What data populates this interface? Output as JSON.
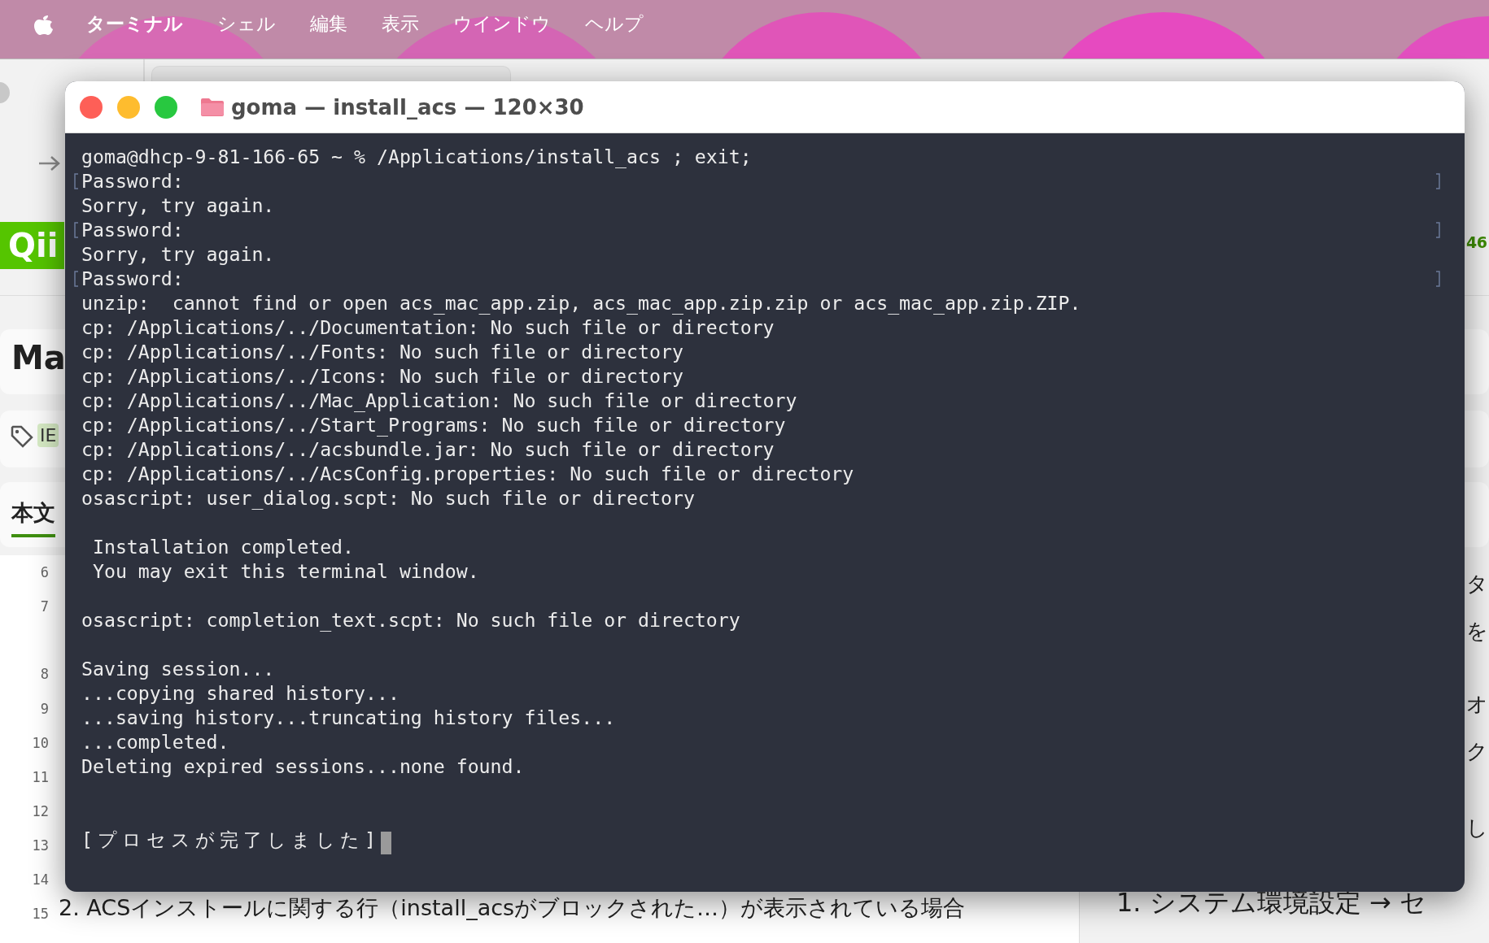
{
  "menu_bar": {
    "items": [
      {
        "label": "ターミナル",
        "selected": true
      },
      {
        "label": "シェル",
        "selected": false
      },
      {
        "label": "編集",
        "selected": false
      },
      {
        "label": "表示",
        "selected": false
      },
      {
        "label": "ウインドウ",
        "selected": false
      },
      {
        "label": "ヘルプ",
        "selected": false
      }
    ]
  },
  "background_page": {
    "logo": "Qii",
    "title": "Ma",
    "tag": "IE",
    "tab": "本文",
    "count": "46",
    "line_numbers": [
      "6",
      "7",
      "8",
      "9",
      "10",
      "11",
      "12",
      "13",
      "14",
      "15"
    ],
    "editor_lines": [
      "2. ACSインストールに関する行（install_acsがブロックされた…）が表示されている場合"
    ],
    "preview_fragments": [
      "タ",
      "を",
      "オ",
      "ク",
      "し"
    ],
    "preview_lines": [
      "1. システム環境設定 → セ"
    ]
  },
  "terminal": {
    "title": "goma — install_acs — 120×30",
    "lines": [
      {
        "kind": "text",
        "text": "goma@dhcp-9-81-166-65 ~ % /Applications/install_acs ; exit;",
        "marked": false
      },
      {
        "kind": "text",
        "text": "Password:",
        "marked": true
      },
      {
        "kind": "text",
        "text": "Sorry, try again.",
        "marked": false
      },
      {
        "kind": "text",
        "text": "Password:",
        "marked": true
      },
      {
        "kind": "text",
        "text": "Sorry, try again.",
        "marked": false
      },
      {
        "kind": "text",
        "text": "Password:",
        "marked": true
      },
      {
        "kind": "text",
        "text": "unzip:  cannot find or open acs_mac_app.zip, acs_mac_app.zip.zip or acs_mac_app.zip.ZIP.",
        "marked": false
      },
      {
        "kind": "text",
        "text": "cp: /Applications/../Documentation: No such file or directory",
        "marked": false
      },
      {
        "kind": "text",
        "text": "cp: /Applications/../Fonts: No such file or directory",
        "marked": false
      },
      {
        "kind": "text",
        "text": "cp: /Applications/../Icons: No such file or directory",
        "marked": false
      },
      {
        "kind": "text",
        "text": "cp: /Applications/../Mac_Application: No such file or directory",
        "marked": false
      },
      {
        "kind": "text",
        "text": "cp: /Applications/../Start_Programs: No such file or directory",
        "marked": false
      },
      {
        "kind": "text",
        "text": "cp: /Applications/../acsbundle.jar: No such file or directory",
        "marked": false
      },
      {
        "kind": "text",
        "text": "cp: /Applications/../AcsConfig.properties: No such file or directory",
        "marked": false
      },
      {
        "kind": "text",
        "text": "osascript: user_dialog.scpt: No such file or directory",
        "marked": false
      },
      {
        "kind": "blank"
      },
      {
        "kind": "text",
        "text": " Installation completed.",
        "marked": false
      },
      {
        "kind": "text",
        "text": " You may exit this terminal window.",
        "marked": false
      },
      {
        "kind": "blank"
      },
      {
        "kind": "text",
        "text": "osascript: completion_text.scpt: No such file or directory",
        "marked": false
      },
      {
        "kind": "blank"
      },
      {
        "kind": "text",
        "text": "Saving session...",
        "marked": false
      },
      {
        "kind": "text",
        "text": "...copying shared history...",
        "marked": false
      },
      {
        "kind": "text",
        "text": "...saving history...truncating history files...",
        "marked": false
      },
      {
        "kind": "text",
        "text": "...completed.",
        "marked": false
      },
      {
        "kind": "text",
        "text": "Deleting expired sessions...none found.",
        "marked": false
      },
      {
        "kind": "blank"
      },
      {
        "kind": "blank"
      },
      {
        "kind": "cursor",
        "text": "[プロセスが完了しました]"
      }
    ]
  }
}
